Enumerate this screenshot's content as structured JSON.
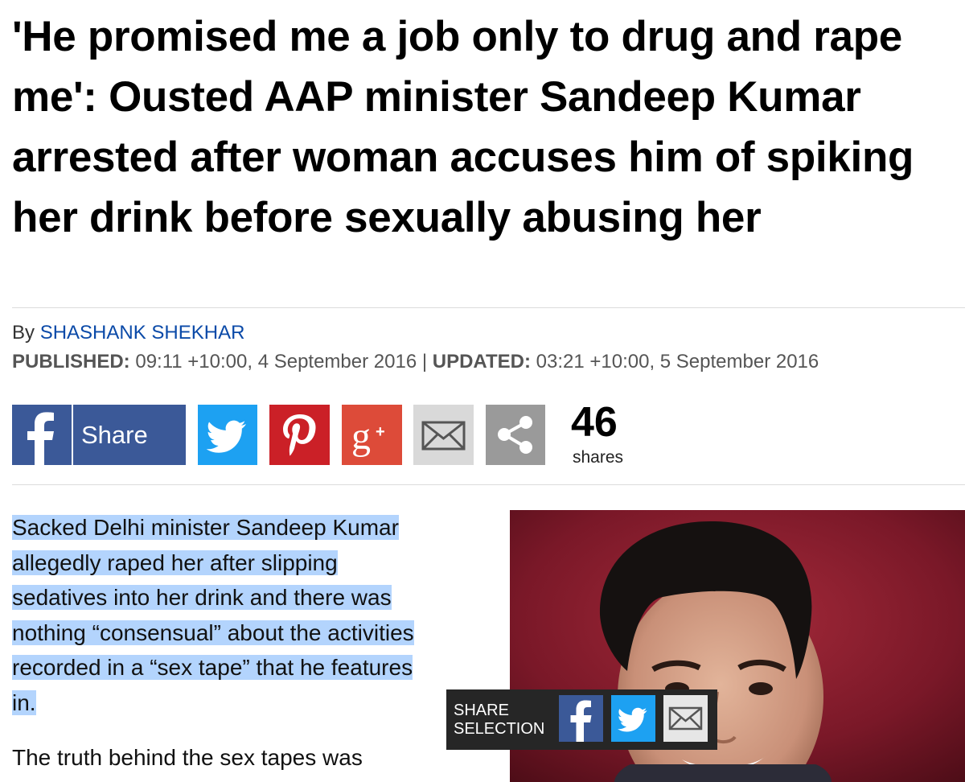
{
  "headline": "'He promised me a job only to drug and rape me': Ousted AAP minister Sandeep Kumar arrested after woman accuses him of spiking her drink before sexually abusing her",
  "byline": {
    "prefix": "By ",
    "author": "SHASHANK SHEKHAR"
  },
  "dates": {
    "published_label": "PUBLISHED:",
    "published_value": " 09:11 +10:00, 4 September 2016 | ",
    "updated_label": "UPDATED:",
    "updated_value": " 03:21 +10:00, 5 September 2016"
  },
  "share_bar": {
    "facebook_label": "Share",
    "count": "46",
    "count_label": "shares",
    "icons": [
      "facebook-icon",
      "twitter-icon",
      "pinterest-icon",
      "google-plus-icon",
      "email-icon",
      "share-icon"
    ],
    "colors": {
      "facebook": "#3b5998",
      "twitter": "#1da1f2",
      "pinterest": "#cb2027",
      "google_plus": "#dd4b39",
      "email": "#d9d9d9",
      "share": "#9a9a9a"
    }
  },
  "article": {
    "lines": [
      "Sacked Delhi minister Sandeep Kumar",
      "allegedly raped her after slipping",
      "sedatives into her drink and there was",
      "nothing “consensual” about the activities",
      "recorded in a “sex tape” that he features",
      "in."
    ],
    "para2": "The truth behind the sex tapes was",
    "selection_color": "#b3d4fd"
  },
  "share_selection": {
    "label_line1": "SHARE",
    "label_line2": "SELECTION",
    "icons": [
      "facebook-icon",
      "twitter-icon",
      "email-icon"
    ]
  }
}
